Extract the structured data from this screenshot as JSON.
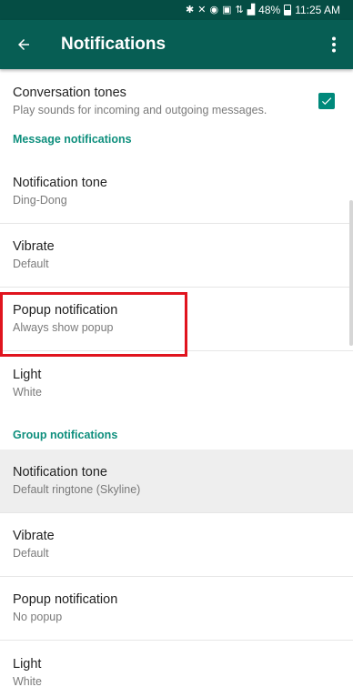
{
  "status_bar": {
    "battery": "48%",
    "time": "11:25 AM",
    "icons": [
      "bluetooth-icon",
      "mute-icon",
      "alarm-icon",
      "notification-icon",
      "data-icon",
      "signal-icon",
      "battery-icon"
    ]
  },
  "toolbar": {
    "title": "Notifications",
    "back_icon": "arrow-back-icon",
    "menu_icon": "more-vert-icon"
  },
  "conversation_tones": {
    "title": "Conversation tones",
    "subtitle": "Play sounds for incoming and outgoing messages.",
    "checked": true
  },
  "message_notifications": {
    "header": "Message notifications",
    "items": [
      {
        "title": "Notification tone",
        "subtitle": "Ding-Dong"
      },
      {
        "title": "Vibrate",
        "subtitle": "Default"
      },
      {
        "title": "Popup notification",
        "subtitle": "Always show popup"
      },
      {
        "title": "Light",
        "subtitle": "White"
      }
    ]
  },
  "group_notifications": {
    "header": "Group notifications",
    "items": [
      {
        "title": "Notification tone",
        "subtitle": "Default ringtone (Skyline)"
      },
      {
        "title": "Vibrate",
        "subtitle": "Default"
      },
      {
        "title": "Popup notification",
        "subtitle": "No popup"
      },
      {
        "title": "Light",
        "subtitle": "White"
      }
    ]
  },
  "colors": {
    "status_bar": "#054d44",
    "toolbar": "#075e54",
    "accent": "#00897b",
    "section_header": "#0e8f7d",
    "highlight": "#e0141e"
  }
}
